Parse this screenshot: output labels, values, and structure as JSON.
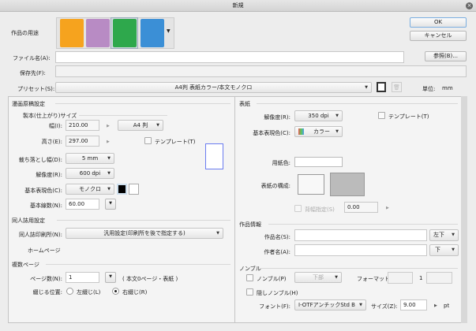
{
  "window": {
    "title": "新規",
    "close": "×"
  },
  "purpose": {
    "label": "作品の用途",
    "icons": [
      "illustration-icon",
      "webtoon-icon",
      "comic-icon",
      "animation-icon"
    ],
    "selected": 2
  },
  "buttons": {
    "ok": "OK",
    "cancel": "キャンセル",
    "browse": "参照(B)..."
  },
  "file": {
    "name_label": "ファイル名(A):",
    "name_value": "",
    "save_label": "保存先(F):",
    "save_value": ""
  },
  "preset": {
    "label": "プリセット(S):",
    "value": "A4判 表紙カラー/本文モノクロ",
    "unit_label": "単位:",
    "unit_value": "mm"
  },
  "manga": {
    "title": "漫画原稿設定",
    "size_title": "製本(仕上がり)サイズ",
    "width_label": "幅(I):",
    "width_value": "210.00",
    "size_preset": "A4 判",
    "height_label": "高さ(E):",
    "height_value": "297.00",
    "template_label": "テンプレート(T)",
    "bleed_label": "裁ち落とし幅(D):",
    "bleed_value": "5 mm",
    "res_label": "解像度(R):",
    "res_value": "600 dpi",
    "color_label": "基本表現色(C):",
    "color_value": "モノクロ",
    "lpi_label": "基本線数(N):",
    "lpi_value": "60.00"
  },
  "doujin": {
    "title": "同人誌用設定",
    "printer_label": "同人誌印刷所(N):",
    "printer_value": "汎用設定(印刷所を後で指定する)",
    "homepage": "ホームページ"
  },
  "pages": {
    "title": "複数ページ",
    "count_label": "ページ数(N):",
    "count_value": "1",
    "count_note": "( 本文0ページ・表紙 )",
    "bind_label": "綴じる位置:",
    "left": "左綴じ(L)",
    "right": "右綴じ(R)",
    "binding": "right"
  },
  "cover": {
    "title": "表紙",
    "res_label": "解像度(R):",
    "res_value": "350 dpi",
    "template_label": "テンプレート(T)",
    "color_label": "基本表現色(C):",
    "color_value": "カラー",
    "paper_label": "用紙色:",
    "layout_label": "表紙の構成:",
    "spine_label": "背幅指定(S)",
    "spine_value": "0.00"
  },
  "info": {
    "title": "作品情報",
    "work_label": "作品名(S):",
    "work_value": "",
    "work_pos": "左下",
    "author_label": "作者名(A):",
    "author_value": "",
    "author_pos": "下"
  },
  "nombre": {
    "title": "ノンブル",
    "nombre_label": "ノンブル(P)",
    "nombre_pos": "下部",
    "format_label": "フォーマット:",
    "format_sep": "1",
    "hidden_label": "隠しノンブル(H)",
    "font_label": "フォント(F):",
    "font_value": "I-OTFアンチックStd B",
    "size_label": "サイズ(Z):",
    "size_value": "9.00",
    "size_unit": "pt"
  }
}
